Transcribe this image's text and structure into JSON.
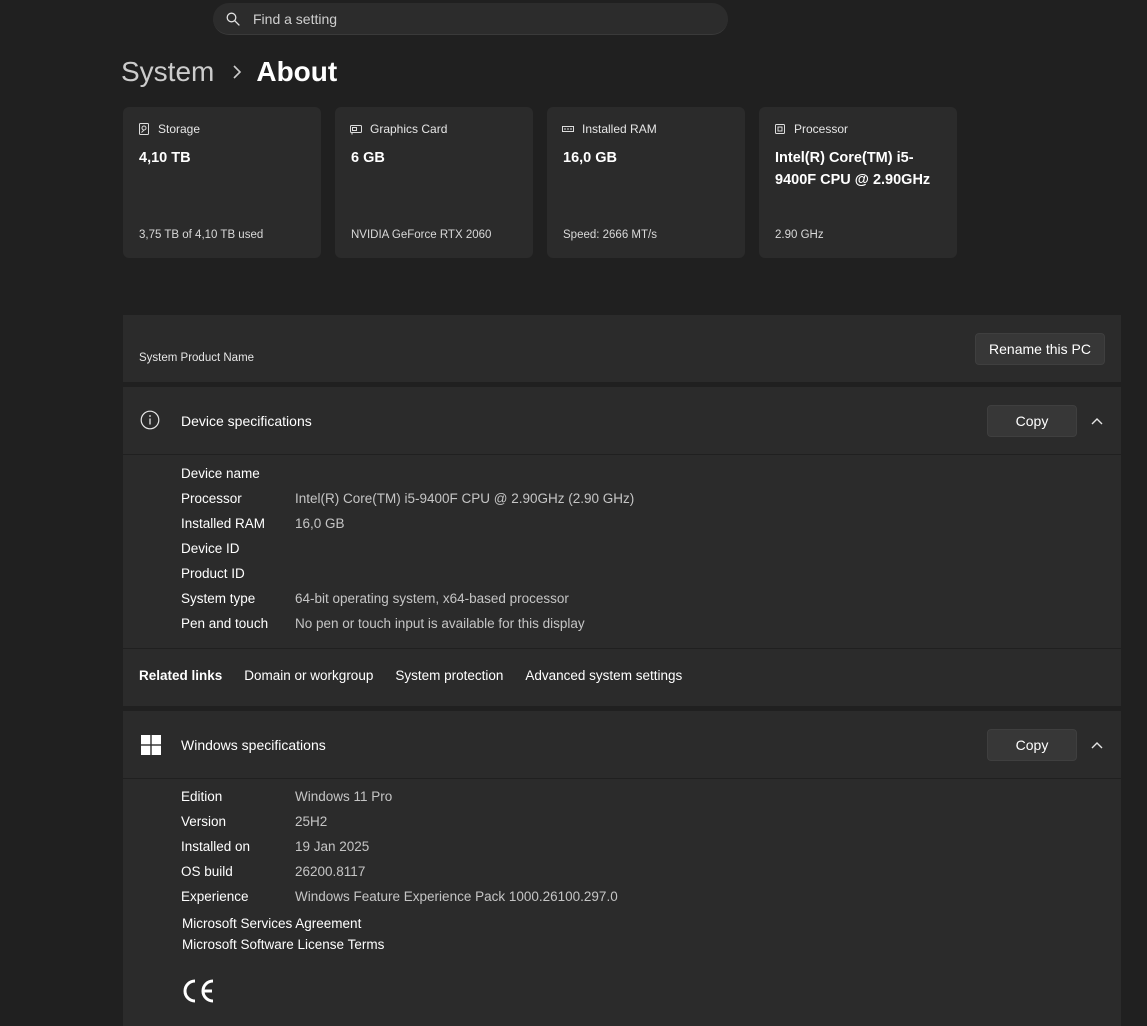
{
  "search": {
    "placeholder": "Find a setting"
  },
  "breadcrumb": {
    "parent": "System",
    "current": "About"
  },
  "cards": [
    {
      "icon": "storage-icon",
      "label": "Storage",
      "value": "4,10 TB",
      "sub": "3,75 TB of 4,10 TB used"
    },
    {
      "icon": "graphics-card-icon",
      "label": "Graphics Card",
      "value": "6 GB",
      "sub": "NVIDIA GeForce RTX 2060"
    },
    {
      "icon": "ram-icon",
      "label": "Installed RAM",
      "value": "16,0 GB",
      "sub": "Speed: 2666 MT/s"
    },
    {
      "icon": "processor-icon",
      "label": "Processor",
      "value": "Intel(R) Core(TM) i5-9400F CPU @ 2.90GHz",
      "sub": "2.90 GHz"
    }
  ],
  "product": {
    "label": "System Product Name",
    "rename_label": "Rename this PC"
  },
  "device_specs": {
    "title": "Device specifications",
    "copy_label": "Copy",
    "rows": [
      {
        "key": "Device name",
        "value": ""
      },
      {
        "key": "Processor",
        "value": "Intel(R) Core(TM) i5-9400F CPU @ 2.90GHz (2.90 GHz)"
      },
      {
        "key": "Installed RAM",
        "value": "16,0 GB"
      },
      {
        "key": "Device ID",
        "value": ""
      },
      {
        "key": "Product ID",
        "value": ""
      },
      {
        "key": "System type",
        "value": "64-bit operating system, x64-based processor"
      },
      {
        "key": "Pen and touch",
        "value": "No pen or touch input is available for this display"
      }
    ]
  },
  "related_links": {
    "label": "Related links",
    "links": [
      "Domain or workgroup",
      "System protection",
      "Advanced system settings"
    ]
  },
  "windows_specs": {
    "title": "Windows specifications",
    "copy_label": "Copy",
    "rows": [
      {
        "key": "Edition",
        "value": "Windows 11 Pro"
      },
      {
        "key": "Version",
        "value": "25H2"
      },
      {
        "key": "Installed on",
        "value": "19 Jan 2025"
      },
      {
        "key": "OS build",
        "value": "26200.8117"
      },
      {
        "key": "Experience",
        "value": "Windows Feature Experience Pack 1000.26100.297.0"
      }
    ],
    "links": [
      "Microsoft Services Agreement",
      "Microsoft Software License Terms"
    ],
    "ce_mark": "CE"
  }
}
